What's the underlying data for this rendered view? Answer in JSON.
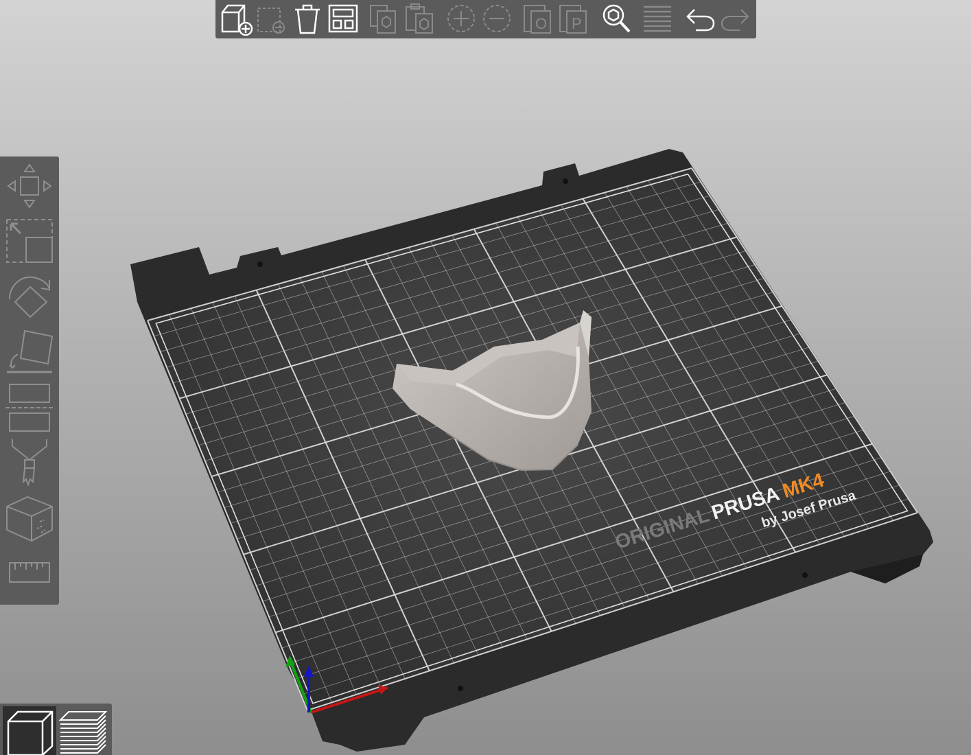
{
  "toolbar": {
    "items": [
      {
        "name": "add-object-button",
        "icon": "add-cube-icon",
        "enabled": true
      },
      {
        "name": "delete-object-button",
        "icon": "delete-cube-icon",
        "enabled": false
      },
      {
        "name": "delete-all-button",
        "icon": "trash-icon",
        "enabled": true
      },
      {
        "name": "arrange-button",
        "icon": "arrange-icon",
        "enabled": true
      },
      {
        "name": "copy-button",
        "icon": "copy-icon",
        "enabled": false
      },
      {
        "name": "paste-button",
        "icon": "paste-icon",
        "enabled": false
      },
      {
        "name": "add-instance-button",
        "icon": "plus-circle-icon",
        "enabled": false
      },
      {
        "name": "remove-instance-button",
        "icon": "minus-circle-icon",
        "enabled": false
      },
      {
        "name": "split-objects-button",
        "icon": "split-objects-icon",
        "enabled": false
      },
      {
        "name": "split-parts-button",
        "icon": "split-parts-icon",
        "enabled": false
      },
      {
        "name": "search-button",
        "icon": "search-icon",
        "enabled": true
      },
      {
        "name": "layers-editing-button",
        "icon": "layers-icon",
        "enabled": false
      },
      {
        "name": "undo-button",
        "icon": "undo-icon",
        "enabled": true
      },
      {
        "name": "redo-button",
        "icon": "redo-icon",
        "enabled": false
      }
    ]
  },
  "left_toolbar": {
    "items": [
      {
        "name": "move-tool",
        "icon": "move-icon"
      },
      {
        "name": "scale-tool",
        "icon": "scale-icon"
      },
      {
        "name": "rotate-tool",
        "icon": "rotate-icon"
      },
      {
        "name": "place-on-face-tool",
        "icon": "place-on-face-icon"
      },
      {
        "name": "cut-tool",
        "icon": "cut-icon"
      },
      {
        "name": "paint-tool",
        "icon": "paint-brush-icon"
      },
      {
        "name": "mesh-boolean-tool",
        "icon": "cube-icon"
      },
      {
        "name": "measure-tool",
        "icon": "ruler-icon"
      }
    ]
  },
  "view_toggle": {
    "items": [
      {
        "name": "3d-view-button",
        "icon": "3d-cube-icon",
        "active": true
      },
      {
        "name": "preview-button",
        "icon": "layers-stack-icon",
        "active": false
      }
    ]
  },
  "bed": {
    "logo_original": "ORIGINAL",
    "logo_prusa": "PRUSA",
    "logo_model": "MK4",
    "logo_byline": "by Josef Prusa"
  },
  "colors": {
    "toolbar_bg": "#5b5b5b",
    "icon_enabled": "#ffffff",
    "icon_disabled": "#8a8a8a",
    "bed_plate": "#2c2c2c",
    "grid_line": "#d8d8d8",
    "logo_accent": "#f08a24",
    "model": "#b0aaa5"
  }
}
